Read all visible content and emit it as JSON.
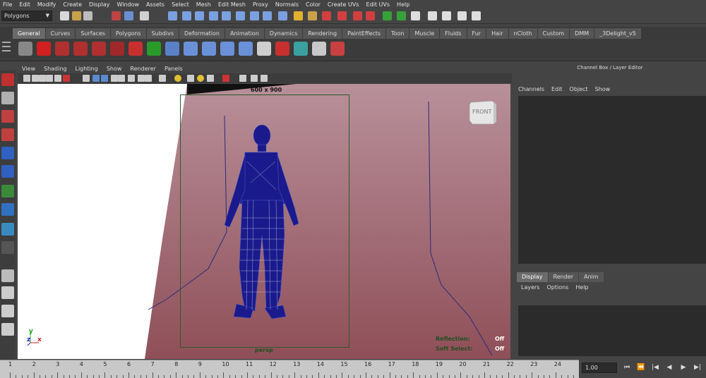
{
  "menubar": [
    "File",
    "Edit",
    "Modify",
    "Create",
    "Display",
    "Window",
    "Assets",
    "Select",
    "Mesh",
    "Edit Mesh",
    "Proxy",
    "Normals",
    "Color",
    "Create UVs",
    "Edit UVs",
    "Help"
  ],
  "statusline": {
    "mode": "Polygons"
  },
  "shelf_tabs": [
    "General",
    "Curves",
    "Surfaces",
    "Polygons",
    "Subdivs",
    "Deformation",
    "Animation",
    "Dynamics",
    "Rendering",
    "PaintEffects",
    "Toon",
    "Muscle",
    "Fluids",
    "Fur",
    "Hair",
    "nCloth",
    "Custom",
    "DMM",
    "_3Delight_v5"
  ],
  "active_shelf_tab": "General",
  "panel_menu": [
    "View",
    "Shading",
    "Lighting",
    "Show",
    "Renderer",
    "Panels"
  ],
  "viewport": {
    "resolution": "600 x 900",
    "camera": "persp",
    "viewcube_label": "FRONT",
    "hud": {
      "reflection_label": "Reflection:",
      "reflection_value": "Off",
      "softselect_label": "Soft Select:",
      "softselect_value": "Off"
    },
    "axis": {
      "y": "y",
      "z": "z",
      "x": "x"
    }
  },
  "channel_box": {
    "title": "Channel Box / Layer Editor",
    "menu": [
      "Channels",
      "Edit",
      "Object",
      "Show"
    ],
    "layer_tabs": [
      "Display",
      "Render",
      "Anim"
    ],
    "layer_menu": [
      "Layers",
      "Options",
      "Help"
    ]
  },
  "timeline": {
    "ticks": [
      "1",
      "2",
      "3",
      "4",
      "5",
      "6",
      "7",
      "8",
      "9",
      "10",
      "11",
      "12",
      "13",
      "14",
      "15",
      "16",
      "17",
      "18",
      "19",
      "20",
      "21",
      "22",
      "23",
      "24"
    ],
    "current_frame": "1.00"
  },
  "colors": {
    "viewport_top": "#b8909a",
    "viewport_bottom": "#8f4f58",
    "mesh": "#1b1a8c"
  }
}
